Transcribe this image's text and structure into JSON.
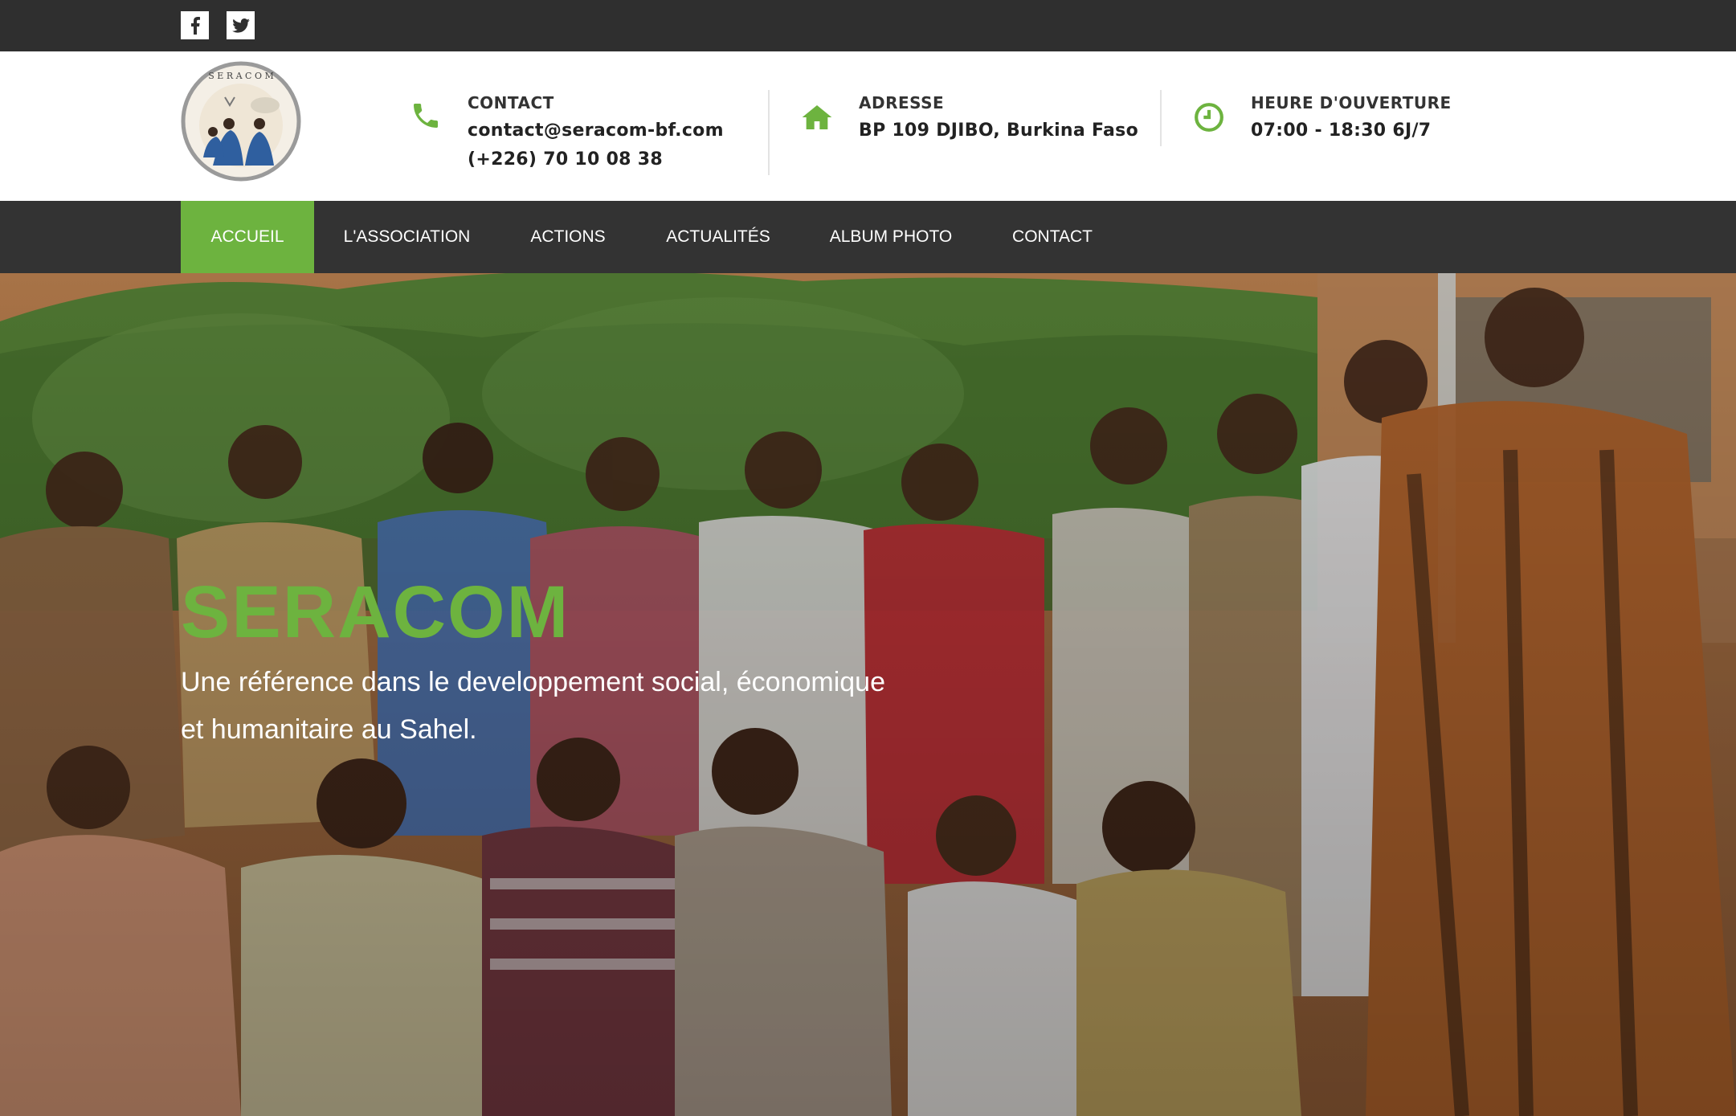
{
  "social": {
    "facebook_icon": "facebook-icon",
    "twitter_icon": "twitter-icon"
  },
  "logo": {
    "text": "SERACOM"
  },
  "contact": {
    "title": "CONTACT",
    "email": "contact@seracom-bf.com",
    "phone": "(+226) 70 10 08 38",
    "icon": "phone-icon"
  },
  "address": {
    "title": "ADRESSE",
    "value": "BP 109 DJIBO, Burkina Faso",
    "icon": "home-icon"
  },
  "hours": {
    "title": "HEURE D'OUVERTURE",
    "value": "07:00 - 18:30 6J/7",
    "icon": "clock-icon"
  },
  "nav": {
    "items": [
      {
        "label": "ACCUEIL",
        "active": true
      },
      {
        "label": "L'ASSOCIATION"
      },
      {
        "label": "ACTIONS"
      },
      {
        "label": "ACTUALITÉS"
      },
      {
        "label": "ALBUM PHOTO"
      },
      {
        "label": "CONTACT"
      }
    ]
  },
  "hero": {
    "title": "SERACOM",
    "subtitle": "Une référence dans le developpement social, économique et humanitaire au Sahel."
  },
  "colors": {
    "accent": "#6db33f",
    "topbar": "#2f2f2f",
    "nav": "#333333"
  }
}
